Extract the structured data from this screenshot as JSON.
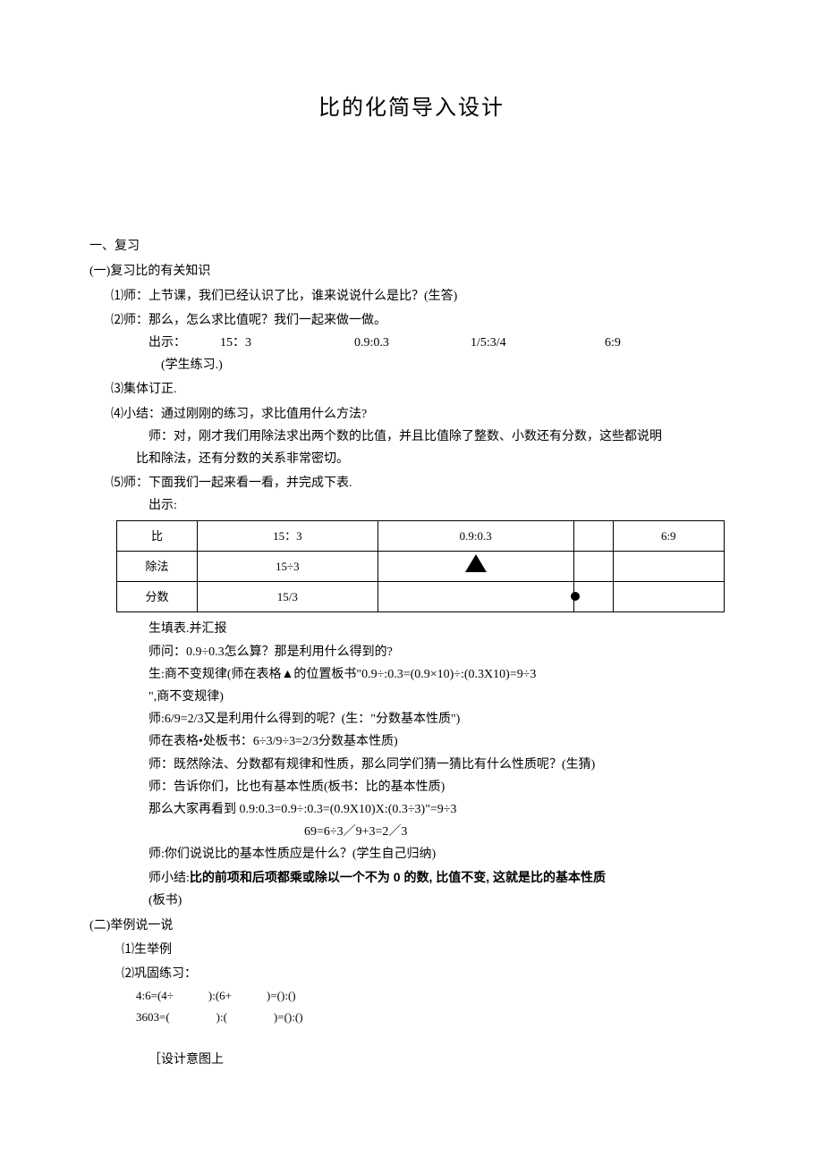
{
  "title": "比的化简导入设计",
  "sec1": "一、复习",
  "sub1": "(一)复习比的有关知识",
  "i1": "⑴师：上节课，我们已经认识了比，谁来说说什么是比？(生答)",
  "i2": "⑵师：那么，怎么求比值呢？我们一起来做一做。",
  "show_label": "出示：",
  "v1": "15：3",
  "v2": "0.9:0.3",
  "v3": "1/5:3/4",
  "v4": "6:9",
  "stu_practice": "(学生练习.)",
  "i3": "⑶集体订正.",
  "i4": "⑷小结：通过刚刚的练习，求比值用什么方法?",
  "i4a": "师：对，刚才我们用除法求出两个数的比值，并且比值除了整数、小数还有分数，这些都说明",
  "i4b": "比和除法，还有分数的关系非常密切。",
  "i5": "⑸师：下面我们一起来看一看，并完成下表.",
  "show2": "出示:",
  "t_r1c1": "比",
  "t_r1c2": "15：3",
  "t_r1c3": "0.9:0.3",
  "t_r1c5": "6:9",
  "t_r2c1": "除法",
  "t_r2c2": "15÷3",
  "t_r3c1": "分数",
  "t_r3c2": "15/3",
  "p1": "生填表.并汇报",
  "p2": "师问：0.9÷0.3怎么算？那是利用什么得到的?",
  "p3": "生:商不变规律(师在表格▲的位置板书\"0.9÷:0.3=(0.9×10)÷:(0.3X10)=9÷3",
  "p3b": "\",商不变规律)",
  "p4": "师:6/9=2/3又是利用什么得到的呢？(生：\"分数基本性质\")",
  "p5": "师在表格•处板书：6÷3/9÷3=2/3分数基本性质)",
  "p6": "师：既然除法、分数都有规律和性质，那么同学们猜一猜比有什么性质呢？(生猜)",
  "p7": "师：告诉你们，比也有基本性质(板书：比的基本性质)",
  "p8": "那么大家再看到 0.9:0.3=0.9÷:0.3=(0.9X10)X:(0.3÷3)\"=9÷3",
  "p8b": "69=6÷3／9+3=2／3",
  "p9": "师:你们说说比的基本性质应是什么？(学生自己归纳)",
  "p10a": "师小结:",
  "p10b": "比的前项和后项都乘或除以一个不为 0 的数, 比值不变, 这就是比的基本性质",
  "p11": "(板书)",
  "sub2": "(二)举例说一说",
  "e1": "⑴生举例",
  "e2": "⑵巩固练习：",
  "ex1": "4:6=(4÷　　　):(6+　　　)=():()",
  "ex2": "3603=(　　　　):(　　　　)=():()",
  "design": "［设计意图上"
}
